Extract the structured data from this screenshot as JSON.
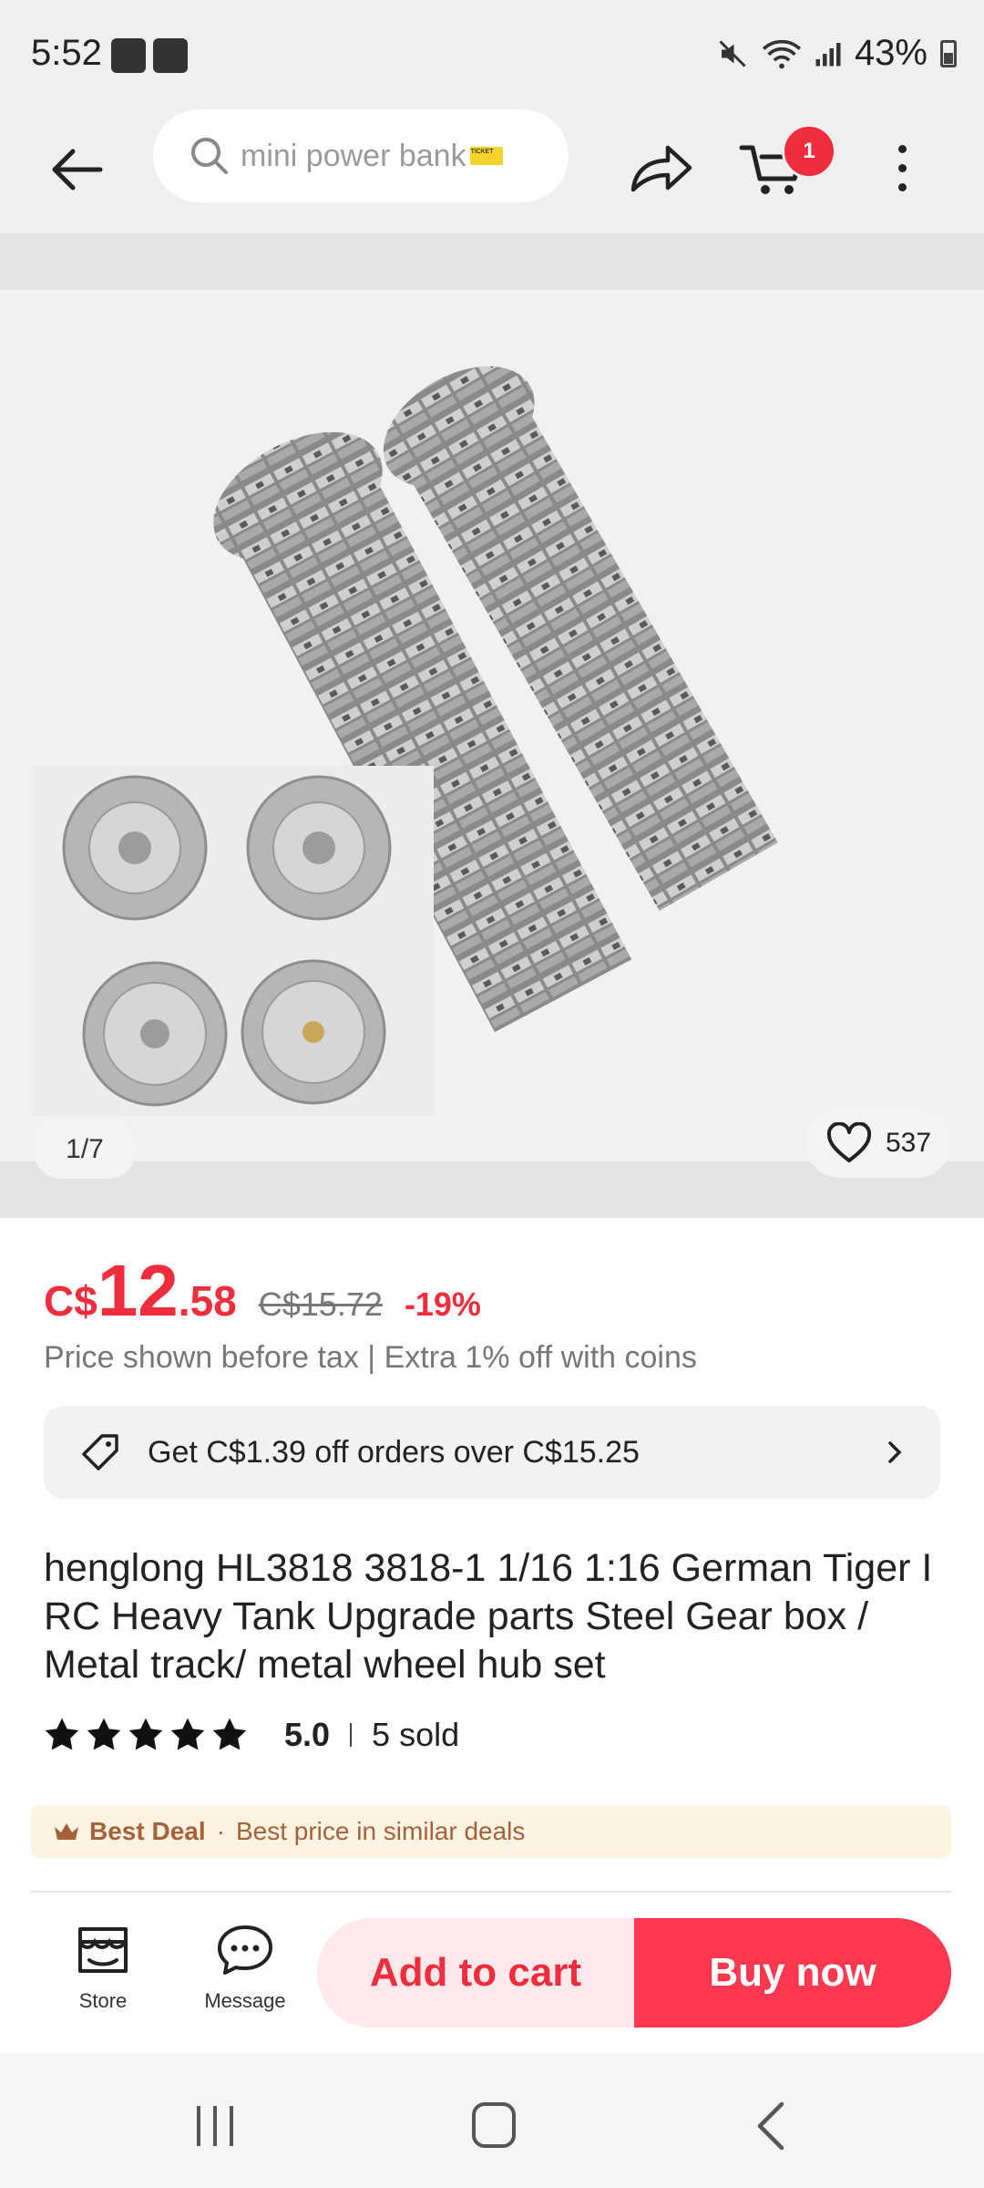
{
  "status_bar": {
    "time": "5:52",
    "battery": "43%"
  },
  "header": {
    "search_placeholder": "mini power bank",
    "ticket_text": "TICKET",
    "cart_count": "1"
  },
  "gallery": {
    "counter": "1/7",
    "wishlist_count": "537"
  },
  "price": {
    "currency": "C$",
    "integer": "12",
    "decimal": ".58",
    "original": "C$15.72",
    "discount": "-19%",
    "tax_note": "Price shown before tax | Extra 1% off with coins"
  },
  "coupon": {
    "text": "Get C$1.39 off orders over C$15.25"
  },
  "product": {
    "title": "henglong HL3818 3818-1 1/16 1:16 German Tiger I RC Heavy Tank Upgrade parts Steel Gear box / Metal track/ metal wheel hub set",
    "rating": "5.0",
    "stars": 5,
    "sold": "5 sold"
  },
  "best_deal": {
    "label": "Best Deal",
    "separator": "·",
    "text": "Best price in similar deals"
  },
  "actions": {
    "store_label": "Store",
    "message_label": "Message",
    "add_to_cart": "Add to cart",
    "buy_now": "Buy now"
  },
  "colors": {
    "accent": "#f02d3d",
    "buy_now_bg": "#fd384f",
    "add_cart_bg": "#fee9ec",
    "best_deal_bg": "#fdf3e2",
    "best_deal_text": "#a5623a"
  }
}
